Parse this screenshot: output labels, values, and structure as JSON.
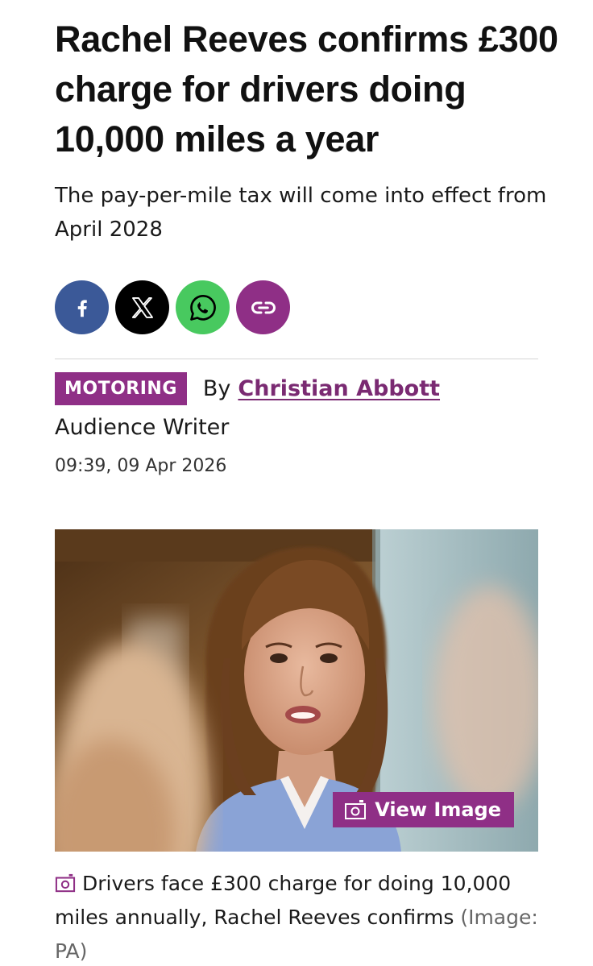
{
  "article": {
    "headline": "Rachel Reeves confirms £300 charge for drivers doing 10,000 miles a year",
    "standfirst": "The pay-per-mile tax will come into effect from April 2028"
  },
  "share": {
    "buttons": [
      {
        "name": "facebook",
        "icon": "facebook-icon",
        "color": "#3b5998"
      },
      {
        "name": "x",
        "icon": "x-icon",
        "color": "#000000"
      },
      {
        "name": "whatsapp",
        "icon": "whatsapp-icon",
        "color": "#48c95f"
      },
      {
        "name": "copy-link",
        "icon": "link-icon",
        "color": "#8f2f86"
      }
    ]
  },
  "byline": {
    "section": "MOTORING",
    "by_prefix": "By",
    "author": "Christian Abbott",
    "role": "Audience Writer",
    "timestamp": "09:39, 09 Apr 2026"
  },
  "hero": {
    "view_image_label": "View Image",
    "caption": "Drivers face £300 charge for doing 10,000 miles annually, Rachel Reeves confirms",
    "credit": "(Image: PA)"
  },
  "colors": {
    "accent": "#8f2f86",
    "author_link": "#7a2a72"
  }
}
